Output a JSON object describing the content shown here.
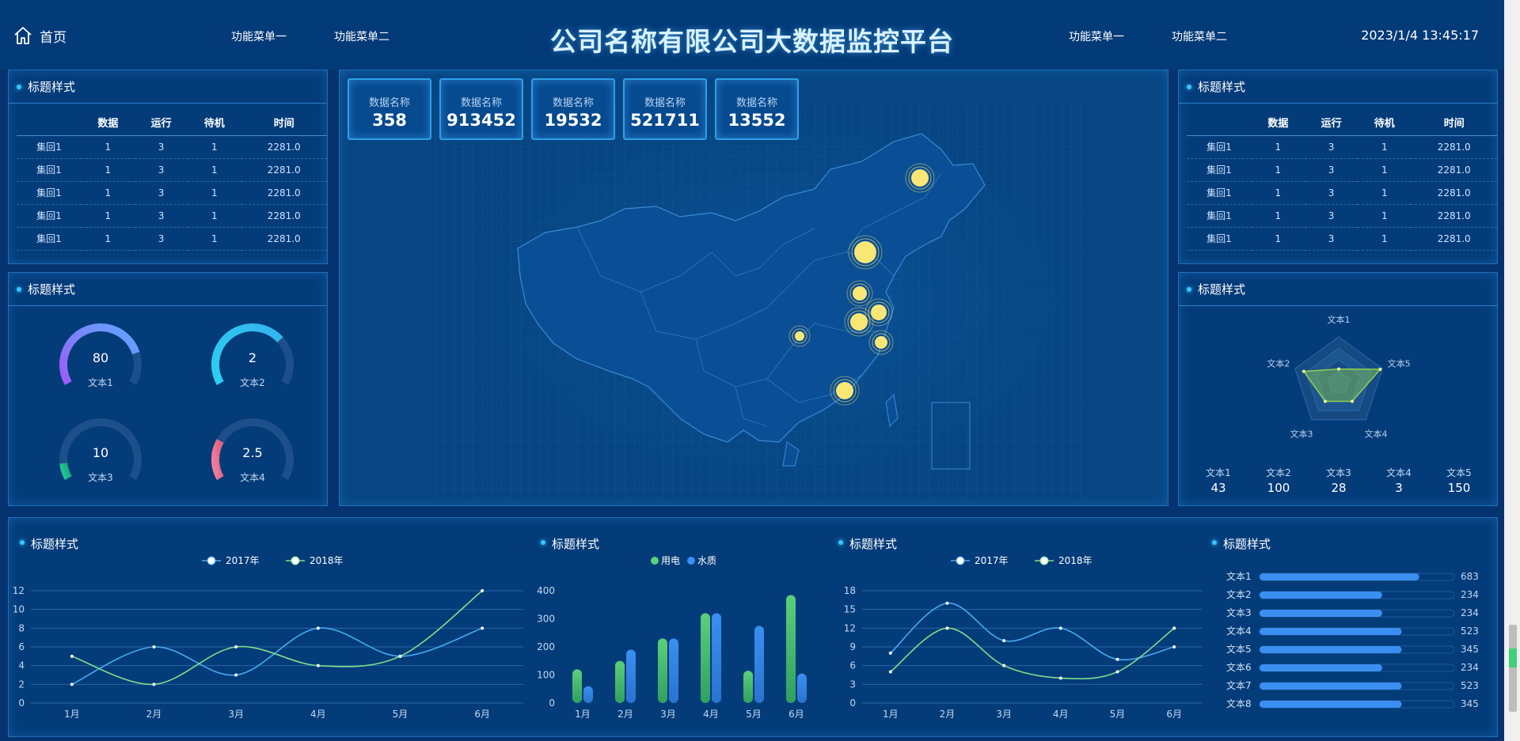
{
  "header": {
    "home": "首页",
    "left_menu": [
      "功能菜单一",
      "功能菜单二"
    ],
    "title": "公司名称有限公司大数据监控平台",
    "right_menu": [
      "功能菜单一",
      "功能菜单二"
    ],
    "clock": "2023/1/4 13:45:17"
  },
  "left_table": {
    "title": "标题样式",
    "columns": [
      "",
      "数据",
      "运行",
      "待机",
      "时间"
    ],
    "rows": [
      [
        "集回1",
        "1",
        "3",
        "1",
        "2281.0"
      ],
      [
        "集回1",
        "1",
        "3",
        "1",
        "2281.0"
      ],
      [
        "集回1",
        "1",
        "3",
        "1",
        "2281.0"
      ],
      [
        "集回1",
        "1",
        "3",
        "1",
        "2281.0"
      ],
      [
        "集回1",
        "1",
        "3",
        "1",
        "2281.0"
      ]
    ]
  },
  "gauges": {
    "title": "标题样式",
    "items": [
      {
        "value": "80",
        "label": "文本1",
        "fraction": 0.8,
        "color_from": "#9b5cf6",
        "color_to": "#5fa8ff"
      },
      {
        "value": "2",
        "label": "文本2",
        "fraction": 0.7,
        "color_from": "#2bd0f0",
        "color_to": "#34b4ef"
      },
      {
        "value": "10",
        "label": "文本3",
        "fraction": 0.1,
        "color_from": "#22c997",
        "color_to": "#1ea37a"
      },
      {
        "value": "2.5",
        "label": "文本4",
        "fraction": 0.25,
        "color_from": "#f07ea0",
        "color_to": "#e0607e"
      }
    ]
  },
  "map": {
    "tags": [
      {
        "label": "数据名称",
        "value": "358"
      },
      {
        "label": "数据名称",
        "value": "913452"
      },
      {
        "label": "数据名称",
        "value": "19532"
      },
      {
        "label": "数据名称",
        "value": "521711"
      },
      {
        "label": "数据名称",
        "value": "13552"
      }
    ]
  },
  "right_table": {
    "title": "标题样式",
    "columns": [
      "",
      "数据",
      "运行",
      "待机",
      "时间"
    ],
    "rows": [
      [
        "集回1",
        "1",
        "3",
        "1",
        "2281.0"
      ],
      [
        "集回1",
        "1",
        "3",
        "1",
        "2281.0"
      ],
      [
        "集回1",
        "1",
        "3",
        "1",
        "2281.0"
      ],
      [
        "集回1",
        "1",
        "3",
        "1",
        "2281.0"
      ],
      [
        "集回1",
        "1",
        "3",
        "1",
        "2281.0"
      ]
    ]
  },
  "radar": {
    "title": "标题样式",
    "stats": [
      {
        "label": "文本1",
        "value": "43"
      },
      {
        "label": "文本2",
        "value": "100"
      },
      {
        "label": "文本3",
        "value": "28"
      },
      {
        "label": "文本4",
        "value": "3"
      },
      {
        "label": "文本5",
        "value": "150"
      }
    ]
  },
  "bottom": {
    "line1_title": "标题样式",
    "bar_title": "标题样式",
    "line2_title": "标题样式",
    "hbar_title": "标题样式"
  },
  "chart_data": [
    {
      "type": "radar",
      "indicators": [
        "文本1",
        "文本5",
        "文本4",
        "文本3",
        "文本2"
      ],
      "values": [
        0.3,
        0.95,
        0.5,
        0.5,
        0.8
      ],
      "color": "#8fd14f"
    },
    {
      "type": "line",
      "categories": [
        "1月",
        "2月",
        "3月",
        "4月",
        "5月",
        "6月"
      ],
      "series": [
        {
          "name": "2017年",
          "values": [
            2,
            6,
            3,
            8,
            5,
            8
          ],
          "color": "#4aa8f0"
        },
        {
          "name": "2018年",
          "values": [
            5,
            2,
            6,
            4,
            5,
            12
          ],
          "color": "#7ee08a"
        }
      ],
      "ylim": [
        0,
        12
      ],
      "yticks": [
        0,
        2,
        4,
        6,
        8,
        10,
        12
      ]
    },
    {
      "type": "bar",
      "categories": [
        "1月",
        "2月",
        "3月",
        "4月",
        "5月",
        "6月"
      ],
      "series": [
        {
          "name": "用电",
          "values": [
            120,
            150,
            230,
            320,
            115,
            385
          ],
          "color": "#5ad07a"
        },
        {
          "name": "水质",
          "values": [
            60,
            190,
            230,
            320,
            275,
            105
          ],
          "color": "#3a8ff0"
        }
      ],
      "ylim": [
        0,
        400
      ],
      "yticks": [
        0,
        100,
        200,
        300,
        400
      ]
    },
    {
      "type": "line",
      "categories": [
        "1月",
        "2月",
        "3月",
        "4月",
        "5月",
        "6月"
      ],
      "series": [
        {
          "name": "2017年",
          "values": [
            8,
            16,
            10,
            12,
            7,
            9
          ],
          "color": "#4aa8f0"
        },
        {
          "name": "2018年",
          "values": [
            5,
            12,
            6,
            4,
            5,
            12
          ],
          "color": "#7ee08a"
        }
      ],
      "ylim": [
        0,
        18
      ],
      "yticks": [
        0,
        3,
        6,
        9,
        12,
        15,
        18
      ]
    },
    {
      "type": "bar",
      "orientation": "horizontal",
      "categories": [
        "文本1",
        "文本2",
        "文本3",
        "文本4",
        "文本5",
        "文本6",
        "文本7",
        "文本8"
      ],
      "values": [
        683,
        234,
        234,
        523,
        345,
        234,
        523,
        345
      ],
      "fill_fraction": [
        0.82,
        0.63,
        0.63,
        0.73,
        0.73,
        0.63,
        0.73,
        0.73
      ],
      "color": "#3a8ff0"
    }
  ]
}
